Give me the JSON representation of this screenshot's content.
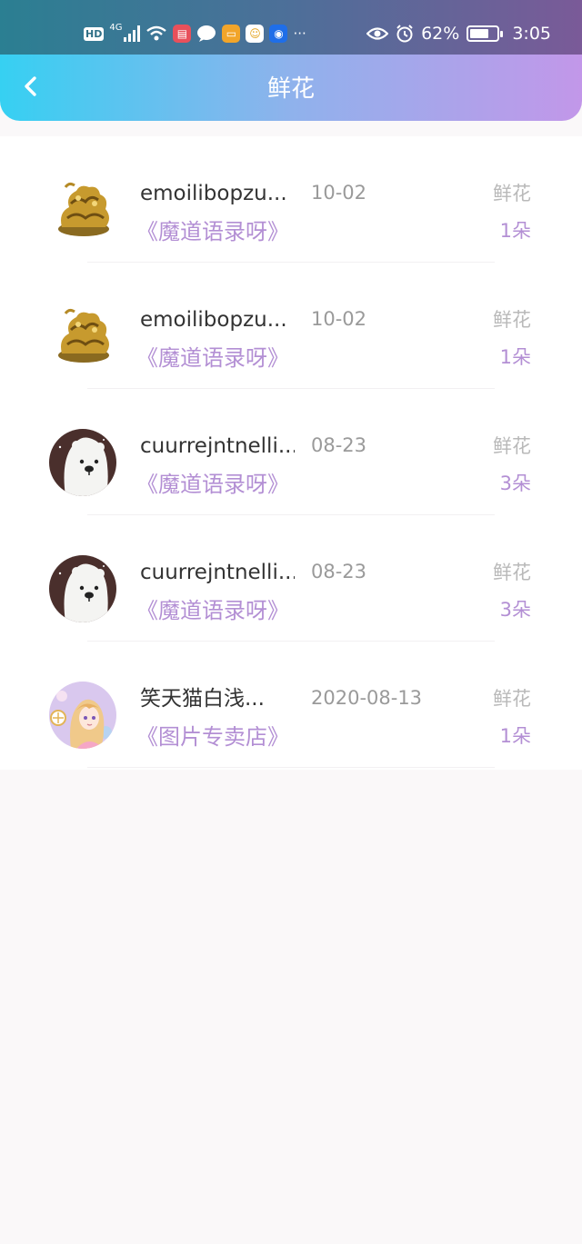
{
  "status_bar": {
    "hd": "HD",
    "network": "4G",
    "more": "···",
    "battery_pct": "62%",
    "time": "3:05",
    "icons": [
      "signal-icon",
      "wifi-icon",
      "notebook-app-icon",
      "message-icon",
      "reader-app-icon",
      "smile-app-icon",
      "bulb-app-icon",
      "eye-icon",
      "alarm-icon",
      "battery-icon"
    ]
  },
  "header": {
    "title": "鲜花",
    "back_icon": "chevron-left-icon"
  },
  "colors": {
    "gradient_start": "#36d0f2",
    "gradient_end": "#c297e9",
    "accent": "#b38fd4"
  },
  "records": [
    {
      "name": "emoilibopzu...",
      "date": "10-02",
      "book": "《魔道语录呀》",
      "gift_type": "鲜花",
      "gift_count": "1朵",
      "avatar": "golden-dragon-avatar"
    },
    {
      "name": "emoilibopzu...",
      "date": "10-02",
      "book": "《魔道语录呀》",
      "gift_type": "鲜花",
      "gift_count": "1朵",
      "avatar": "golden-dragon-avatar"
    },
    {
      "name": "cuurrejntnelli...",
      "date": "08-23",
      "book": "《魔道语录呀》",
      "gift_type": "鲜花",
      "gift_count": "3朵",
      "avatar": "polar-bear-avatar"
    },
    {
      "name": "cuurrejntnelli...",
      "date": "08-23",
      "book": "《魔道语录呀》",
      "gift_type": "鲜花",
      "gift_count": "3朵",
      "avatar": "polar-bear-avatar"
    },
    {
      "name": "笑天猫白浅...",
      "date": "2020-08-13",
      "book": "《图片专卖店》",
      "gift_type": "鲜花",
      "gift_count": "1朵",
      "avatar": "anime-girl-avatar"
    }
  ]
}
